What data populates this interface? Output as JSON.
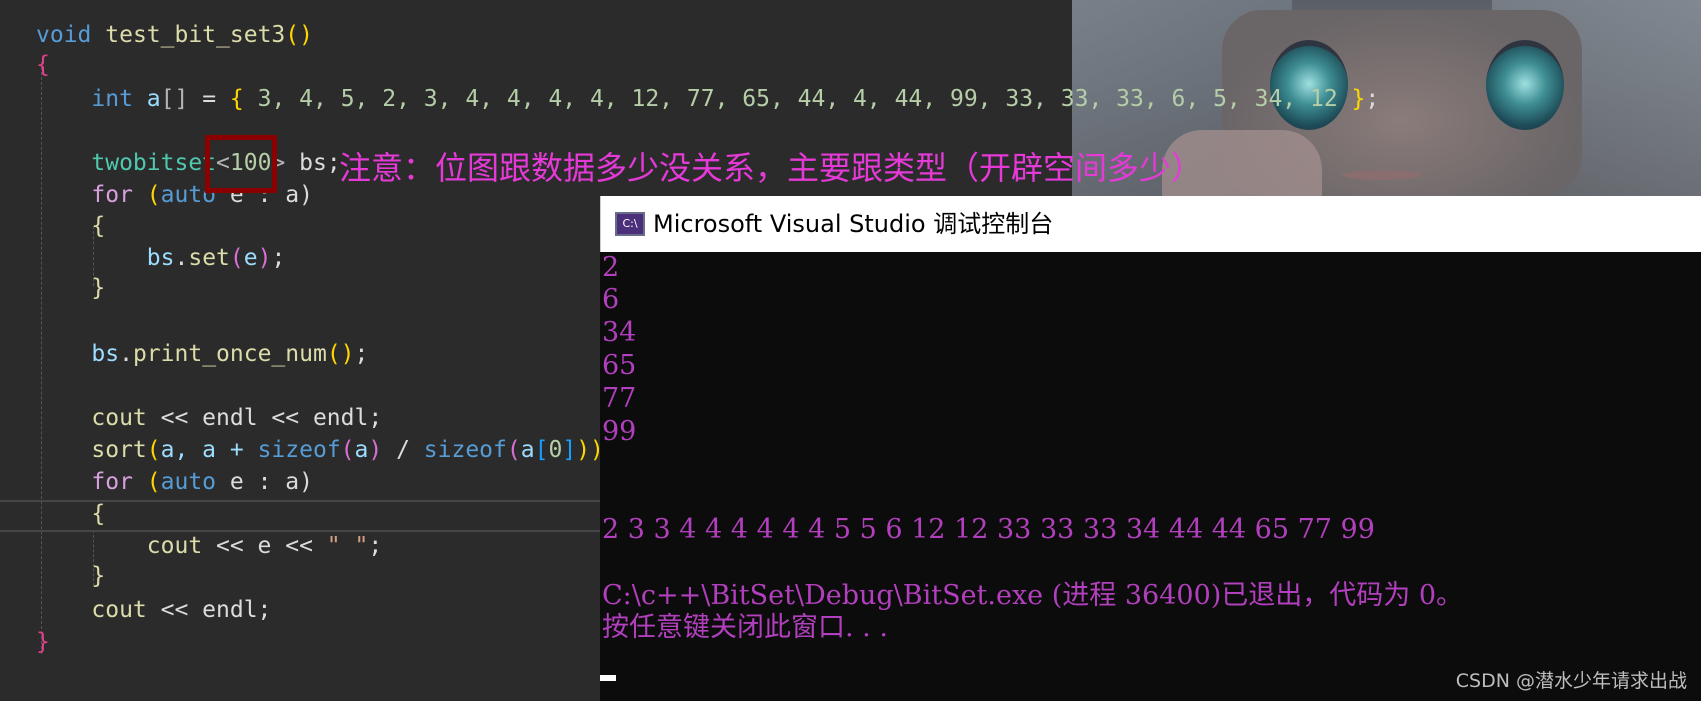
{
  "code": {
    "l1": {
      "kw": "void",
      "fn": "test_bit_set3",
      "p": "()"
    },
    "l2": "{",
    "l3": {
      "kw": "int",
      "var": "a",
      "arr": "[]",
      "eq": " = ",
      "ob": "{",
      "vals": " 3, 4, 5, 2, 3, 4, 4, 4, 4, 12, 77, 65, 44, 4, 44, 99, 33, 33, 33, 6, 5, 34, 12 ",
      "cb": "}",
      "semi": ";"
    },
    "l4": {
      "ty": "twobitset",
      "lt": "<",
      "num": "100",
      "gt": ">",
      "rest": " bs;"
    },
    "l5": {
      "kw": "for",
      "p1": " (",
      "kw2": "auto",
      "rest": " e : a)"
    },
    "l6": "{",
    "l7": {
      "var": "bs",
      "dot": ".",
      "fn": "set",
      "p1": "(",
      "arg": "e",
      "p2": ")",
      "semi": ";"
    },
    "l8": "}",
    "l9": {
      "var": "bs",
      "dot": ".",
      "fn": "print_once_num",
      "p": "()",
      "semi": ";"
    },
    "l10": {
      "fn": "cout",
      "rest": " << endl << endl;"
    },
    "l11": {
      "fn": "sort",
      "p1": "(",
      "a1": "a, a + ",
      "kw": "sizeof",
      "p2": "(",
      "a2": "a",
      "p3": ")",
      "div": " / ",
      "kw2": "sizeof",
      "p4": "(",
      "a3": "a",
      "b1": "[",
      "n": "0",
      "b2": "]",
      "p5": "))",
      "semi": ";"
    },
    "l12": {
      "kw": "for",
      "p1": " (",
      "kw2": "auto",
      "rest": " e : a)"
    },
    "l13": "{",
    "l14": {
      "fn": "cout",
      "rest1": " << e << ",
      "str": "\" \"",
      "semi": ";"
    },
    "l15": "}",
    "l16": {
      "fn": "cout",
      "rest": " << endl;"
    },
    "l17": "}"
  },
  "note": "注意：位图跟数据多少没关系，主要跟类型（开辟空间多少）",
  "console": {
    "icon": "C:\\",
    "title": "Microsoft Visual Studio 调试控制台",
    "lines": [
      "2",
      "6",
      "34",
      "65",
      "77",
      "99"
    ],
    "sorted": "2 3 3 4 4 4 4 4 4 5 5 6 12 12 33 33 33 34 44 44 65 77 99",
    "exit_line": "C:\\c++\\BitSet\\Debug\\BitSet.exe (进程 36400)已退出，代码为 0。",
    "press_key": "按任意键关闭此窗口. . ."
  },
  "watermark": "CSDN @潜水少年请求出战"
}
